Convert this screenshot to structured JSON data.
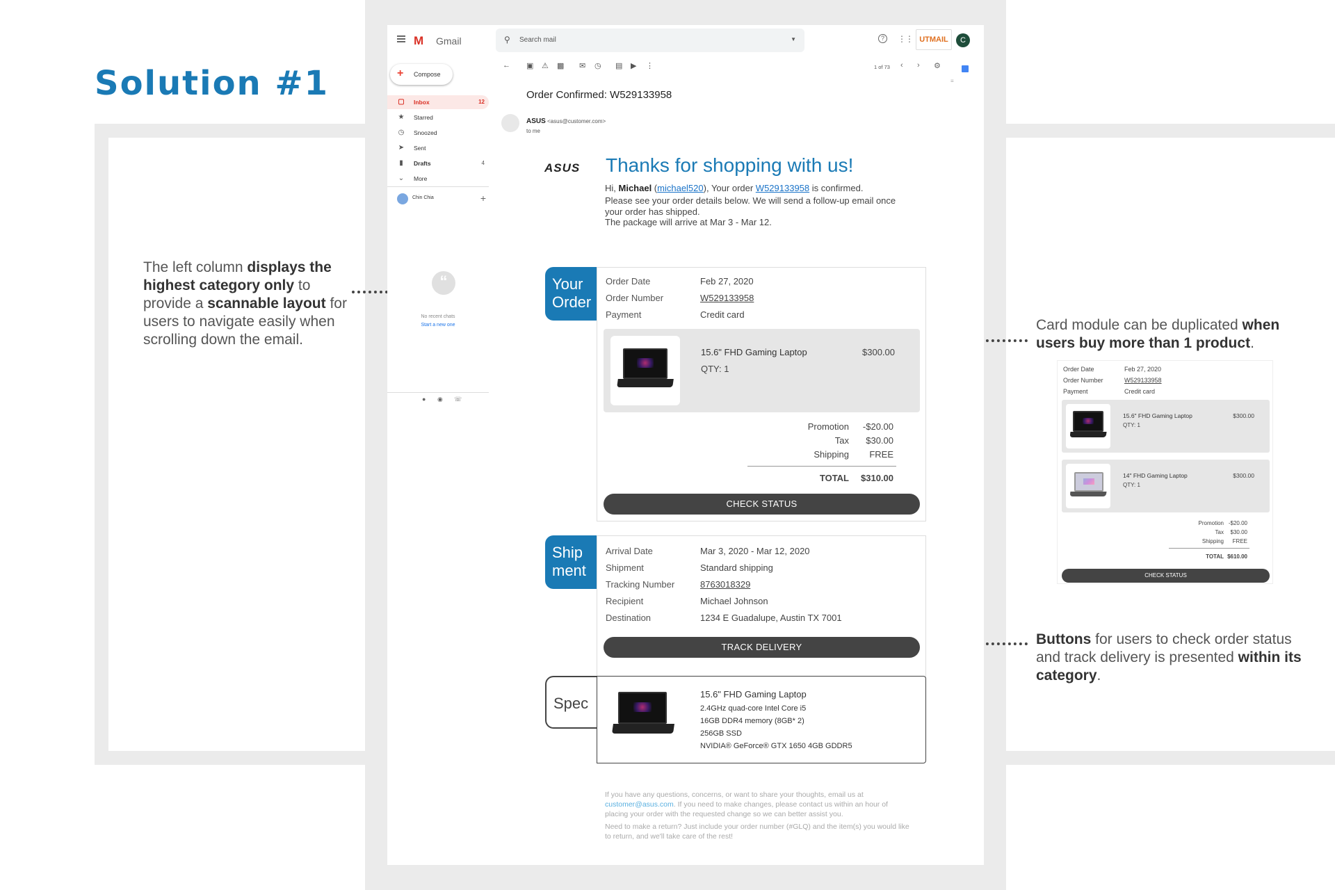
{
  "slide": {
    "title": "Solution #1",
    "annotation_left": {
      "parts": [
        {
          "t": "The left column ",
          "b": false
        },
        {
          "t": "displays the highest category only",
          "b": true
        },
        {
          "t": " to provide a ",
          "b": false
        },
        {
          "t": "scannable layout",
          "b": true
        },
        {
          "t": " for users to navigate easily when scrolling down the email.",
          "b": false
        }
      ]
    },
    "annotation_right_top": {
      "parts": [
        {
          "t": "Card module can be duplicated ",
          "b": false
        },
        {
          "t": "when users buy more than 1 product",
          "b": true
        },
        {
          "t": ".",
          "b": false
        }
      ]
    },
    "annotation_right_bottom": {
      "parts": [
        {
          "t": "Buttons",
          "b": true
        },
        {
          "t": " for users to check order status and track delivery is presented ",
          "b": false
        },
        {
          "t": "within its category",
          "b": true
        },
        {
          "t": ".",
          "b": false
        }
      ]
    }
  },
  "gmail": {
    "app_name": "Gmail",
    "search_placeholder": "Search mail",
    "brand_badge": "UTMAIL",
    "avatar_letter": "C",
    "compose_label": "Compose",
    "nav": [
      {
        "label": "Inbox",
        "count": "12",
        "icon": "inbox-icon"
      },
      {
        "label": "Starred",
        "count": "",
        "icon": "star-icon"
      },
      {
        "label": "Snoozed",
        "count": "",
        "icon": "clock-icon"
      },
      {
        "label": "Sent",
        "count": "",
        "icon": "send-icon"
      },
      {
        "label": "Drafts",
        "count": "4",
        "icon": "draft-icon"
      },
      {
        "label": "More",
        "count": "",
        "icon": "chevron-down-icon"
      }
    ],
    "user_name": "Chin Chia",
    "no_recent_chats": "No recent chats",
    "start_new": "Start a new one",
    "pager": "1 of 73"
  },
  "email": {
    "subject": "Order Confirmed: W529133958",
    "sender_name": "ASUS",
    "sender_addr": "<asus@customer.com>",
    "to": "to me",
    "brand": "ASUS",
    "headline": "Thanks for shopping with us!",
    "greeting_hi": "Hi, ",
    "customer": "Michael",
    "open_paren": " (",
    "username": "michael520",
    "your_order": "), Your order ",
    "order_no": "W529133958",
    "confirmed": " is confirmed.",
    "details_line": "Please see your order details below. We will send a follow-up email once your order has shipped.",
    "arrival_line": "The package will arrive at Mar 3 - Mar 12.",
    "tab_order": [
      "Your",
      "Order"
    ],
    "tab_shipment": [
      "Ship",
      "ment"
    ],
    "tab_spec": "Spec",
    "order": {
      "date_label": "Order Date",
      "date": "Feb 27, 2020",
      "number_label": "Order Number",
      "number": "W529133958",
      "payment_label": "Payment",
      "payment": "Credit card",
      "product": "15.6\" FHD Gaming Laptop",
      "qty": "QTY: 1",
      "price": "$300.00",
      "promotion_label": "Promotion",
      "promotion": "-$20.00",
      "tax_label": "Tax",
      "tax": "$30.00",
      "shipping_label": "Shipping",
      "shipping": "FREE",
      "total_label": "TOTAL",
      "total": "$310.00",
      "button": "CHECK STATUS"
    },
    "shipment": {
      "arrival_label": "Arrival Date",
      "arrival": "Mar 3, 2020 - Mar 12, 2020",
      "shipment_label": "Shipment",
      "shipment": "Standard shipping",
      "tracking_label": "Tracking Number",
      "tracking": "8763018329",
      "recipient_label": "Recipient",
      "recipient": "Michael Johnson",
      "destination_label": "Destination",
      "destination": "1234 E Guadalupe, Austin TX 7001",
      "button": "TRACK DELIVERY"
    },
    "spec": {
      "name": "15.6\" FHD Gaming Laptop",
      "lines": [
        "2.4GHz quad-core Intel Core i5",
        "16GB DDR4 memory (8GB* 2)",
        "256GB SSD",
        "NVIDIA® GeForce® GTX 1650 4GB GDDR5"
      ]
    },
    "footer": {
      "p1_a": "If you have any questions, concerns, or want to share your thoughts, email us at ",
      "p1_link": "customer@asus.com",
      "p1_b": ". If you need to make changes, please contact us within an hour of placing your order with the requested change so we can better assist you.",
      "p2": "Need to make a return? Just include your order number (#GLQ) and the item(s) you would like to return, and we'll take care of the rest!"
    }
  },
  "mini_card": {
    "date_label": "Order Date",
    "date": "Feb 27, 2020",
    "number_label": "Order Number",
    "number": "W529133958",
    "payment_label": "Payment",
    "payment": "Credit card",
    "products": [
      {
        "name": "15.6\" FHD Gaming Laptop",
        "qty": "QTY: 1",
        "price": "$300.00"
      },
      {
        "name": "14\" FHD Gaming Laptop",
        "qty": "QTY: 1",
        "price": "$300.00"
      }
    ],
    "promotion_label": "Promotion",
    "promotion": "-$20.00",
    "tax_label": "Tax",
    "tax": "$30.00",
    "shipping_label": "Shipping",
    "shipping": "FREE",
    "total_label": "TOTAL",
    "total": "$610.00",
    "button": "CHECK STATUS"
  },
  "colors": {
    "accent": "#1a7ab5",
    "dark_button": "#444444",
    "gmail_red": "#d93025"
  }
}
